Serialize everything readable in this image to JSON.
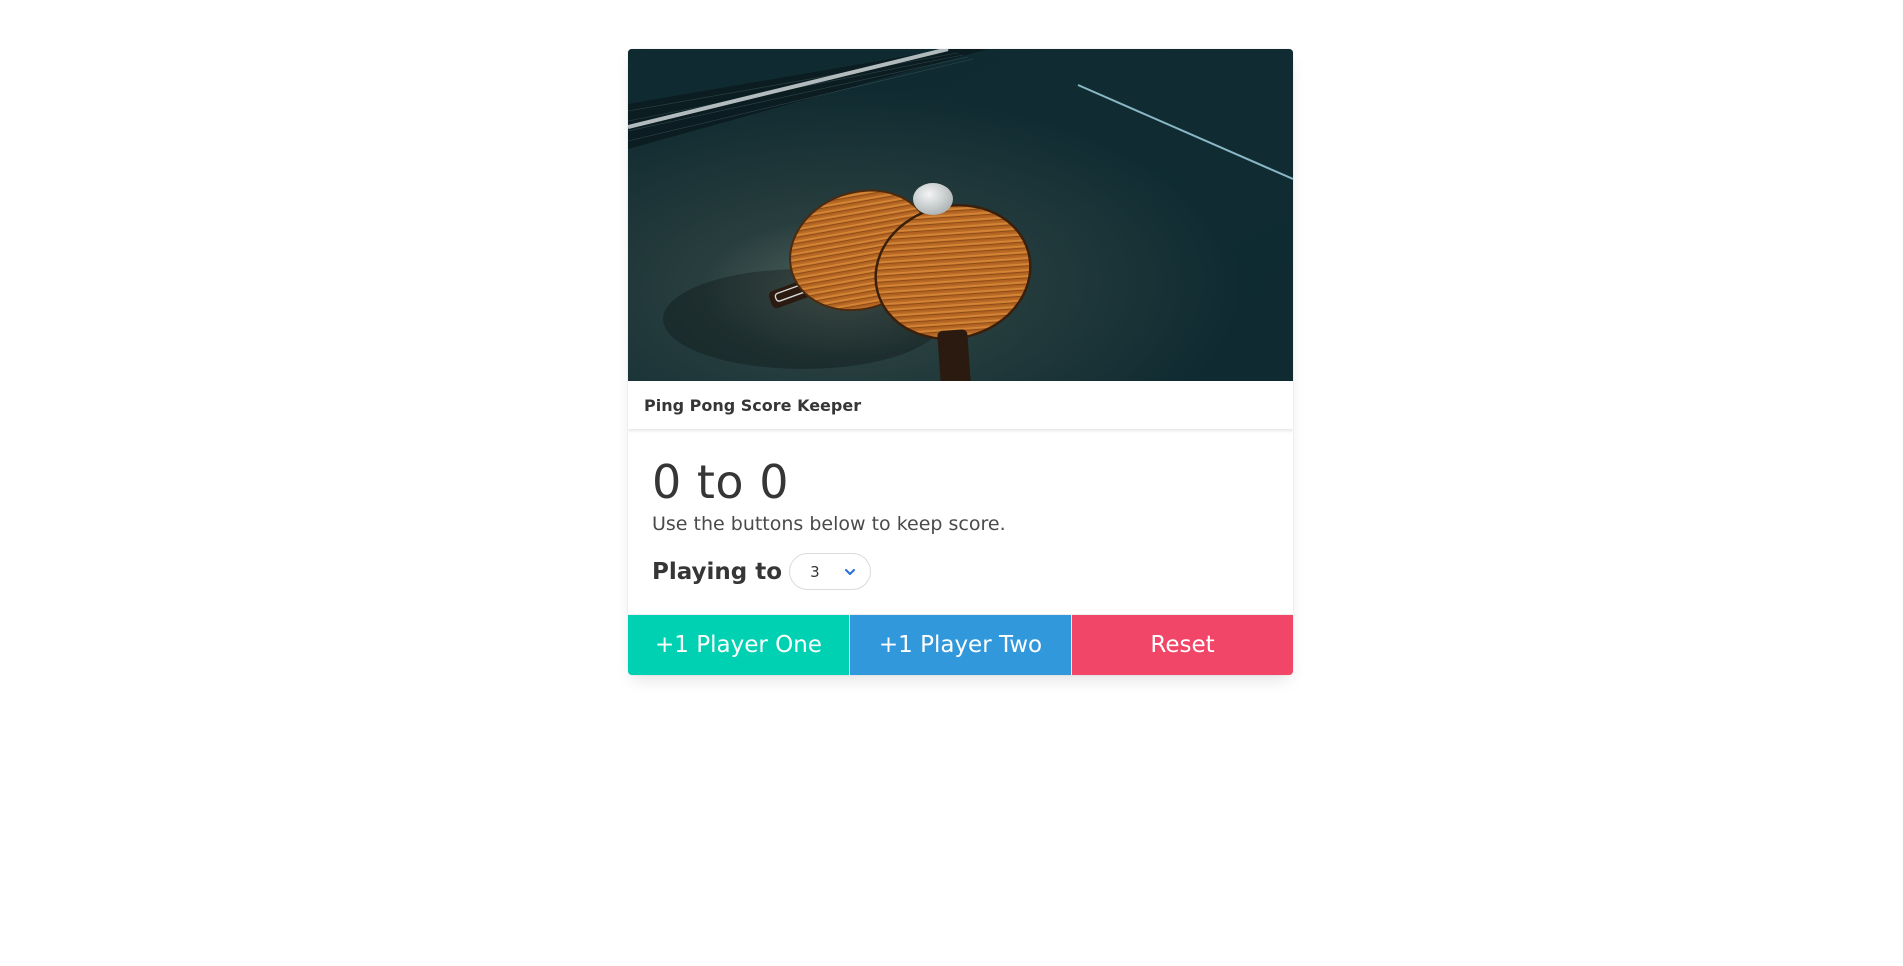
{
  "card": {
    "image_alt": "ping pong paddles on table",
    "header_title": "Ping Pong Score Keeper"
  },
  "scoreboard": {
    "score_text": "0 to 0",
    "subtitle": "Use the buttons below to keep score."
  },
  "playing_to": {
    "label": "Playing to",
    "selected_value": "3"
  },
  "buttons": {
    "player_one": "+1 Player One",
    "player_two": "+1 Player Two",
    "reset": "Reset"
  },
  "colors": {
    "player_one": "#00d1b2",
    "player_two": "#3298dc",
    "reset": "#f14668"
  },
  "icons": {
    "select_arrow": "chevron-down-icon"
  }
}
